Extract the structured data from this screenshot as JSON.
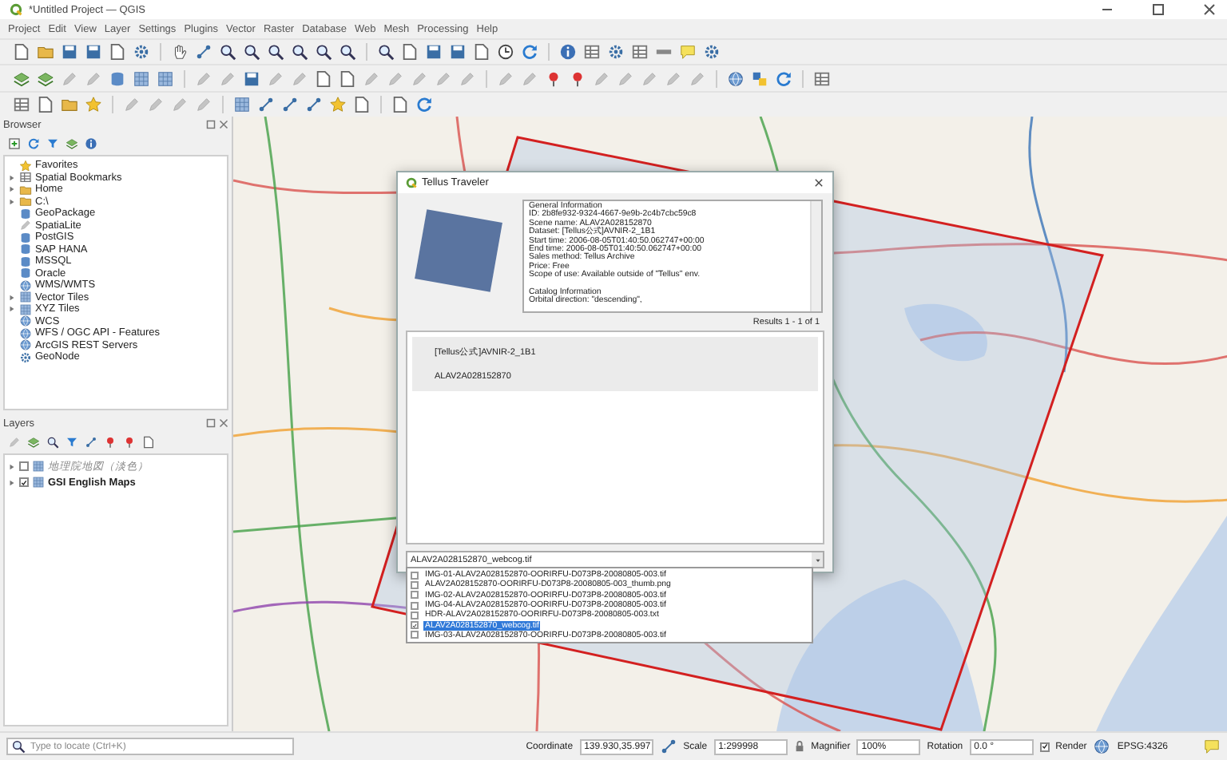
{
  "window": {
    "title": "*Untitled Project — QGIS"
  },
  "menu": [
    "Project",
    "Edit",
    "View",
    "Layer",
    "Settings",
    "Plugins",
    "Vector",
    "Raster",
    "Database",
    "Web",
    "Mesh",
    "Processing",
    "Help"
  ],
  "browser": {
    "title": "Browser",
    "items": [
      {
        "label": "Favorites",
        "expandable": false
      },
      {
        "label": "Spatial Bookmarks",
        "expandable": true
      },
      {
        "label": "Home",
        "expandable": true
      },
      {
        "label": "C:\\",
        "expandable": true
      },
      {
        "label": "GeoPackage",
        "expandable": false
      },
      {
        "label": "SpatiaLite",
        "expandable": false
      },
      {
        "label": "PostGIS",
        "expandable": false
      },
      {
        "label": "SAP HANA",
        "expandable": false
      },
      {
        "label": "MSSQL",
        "expandable": false
      },
      {
        "label": "Oracle",
        "expandable": false
      },
      {
        "label": "WMS/WMTS",
        "expandable": false
      },
      {
        "label": "Vector Tiles",
        "expandable": true
      },
      {
        "label": "XYZ Tiles",
        "expandable": true
      },
      {
        "label": "WCS",
        "expandable": false
      },
      {
        "label": "WFS / OGC API - Features",
        "expandable": false
      },
      {
        "label": "ArcGIS REST Servers",
        "expandable": false
      },
      {
        "label": "GeoNode",
        "expandable": false
      }
    ]
  },
  "layers": {
    "title": "Layers",
    "items": [
      {
        "label": "地理院地図（淡色）",
        "checked": false
      },
      {
        "label": "GSI English Maps",
        "checked": true
      }
    ]
  },
  "dialog": {
    "title": "Tellus Traveler",
    "info": [
      [
        "General Information",
        "ID: 2b8fe932-9324-4667-9e9b-2c4b7cbc59c8",
        "Scene name: ALAV2A028152870",
        "Dataset: [Tellus公式]AVNIR-2_1B1",
        "Start time: 2006-08-05T01:40:50.062747+00:00",
        "End time: 2006-08-05T01:40:50.062747+00:00",
        "Sales method: Tellus Archive",
        "Price: Free",
        "Scope of use: Available outside of \"Tellus\" env."
      ],
      [
        "Catalog Information",
        "Orbital direction: \"descending\","
      ]
    ],
    "results": "Results 1 - 1 of 1",
    "scenes": [
      {
        "dataset": "[Tellus公式]AVNIR-2_1B1",
        "name": "ALAV2A028152870",
        "selected": true
      }
    ],
    "file_combo": {
      "value": "ALAV2A028152870_webcog.tif"
    },
    "files": [
      {
        "label": "IMG-01-ALAV2A028152870-OORIRFU-D073P8-20080805-003.tif",
        "checked": false,
        "selected": false
      },
      {
        "label": "ALAV2A028152870-OORIRFU-D073P8-20080805-003_thumb.png",
        "checked": false,
        "selected": false
      },
      {
        "label": "IMG-02-ALAV2A028152870-OORIRFU-D073P8-20080805-003.tif",
        "checked": false,
        "selected": false
      },
      {
        "label": "IMG-04-ALAV2A028152870-OORIRFU-D073P8-20080805-003.tif",
        "checked": false,
        "selected": false
      },
      {
        "label": "HDR-ALAV2A028152870-OORIRFU-D073P8-20080805-003.txt",
        "checked": false,
        "selected": false
      },
      {
        "label": "ALAV2A028152870_webcog.tif",
        "checked": true,
        "selected": true
      },
      {
        "label": "IMG-03-ALAV2A028152870-OORIRFU-D073P8-20080805-003.tif",
        "checked": false,
        "selected": false
      }
    ]
  },
  "status_bar": {
    "locator": {
      "placeholder": "Type to locate (Ctrl+K)"
    },
    "coordinate": {
      "label": "Coordinate",
      "value": "139.930,35.997"
    },
    "scale": {
      "label": "Scale",
      "value": "1:299998"
    },
    "magnifier": {
      "label": "Magnifier",
      "value": "100%"
    },
    "rotation": {
      "label": "Rotation",
      "value": "0.0 °"
    },
    "render": {
      "label": "Render",
      "checked": true
    },
    "crs": "EPSG:4326"
  }
}
